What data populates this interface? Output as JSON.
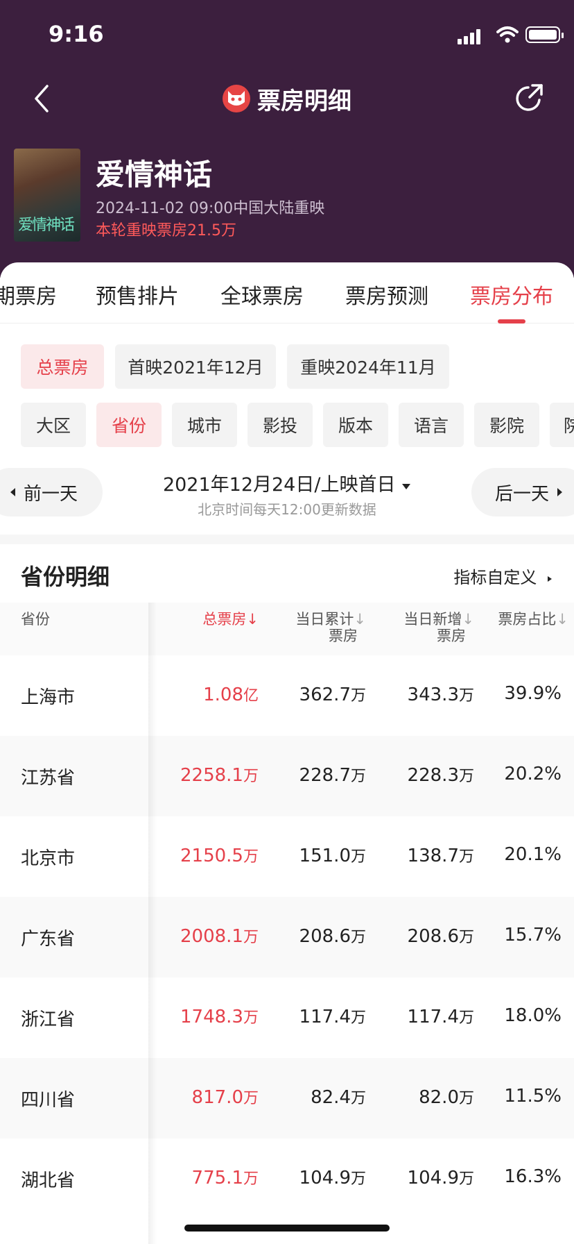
{
  "status_bar": {
    "time": "9:16"
  },
  "nav": {
    "title": "票房明细"
  },
  "movie": {
    "title": "爱情神话",
    "release": "2024-11-02 09:00中国大陆重映",
    "round_box_office": "本轮重映票房21.5万",
    "poster_text": "爱情神话"
  },
  "tabs": [
    "期票房",
    "预售排片",
    "全球票房",
    "票房预测",
    "票房分布"
  ],
  "filters": {
    "period": [
      "总票房",
      "首映2021年12月",
      "重映2024年11月"
    ],
    "dimension": [
      "大区",
      "省份",
      "城市",
      "影投",
      "版本",
      "语言",
      "影院",
      "院"
    ]
  },
  "date_nav": {
    "prev": "前一天",
    "next": "后一天",
    "date": "2021年12月24日/上映首日",
    "note": "北京时间每天12:00更新数据"
  },
  "section": {
    "title": "省份明细",
    "custom": "指标自定义"
  },
  "table": {
    "headers": {
      "province": "省份",
      "total": "总票房",
      "day_cum_1": "当日累计",
      "day_cum_2": "票房",
      "day_new_1": "当日新增",
      "day_new_2": "票房",
      "share": "票房占比"
    },
    "rows": [
      {
        "province": "上海市",
        "total": "1.08",
        "total_unit": "亿",
        "day_cum": "362.7",
        "day_new": "343.3",
        "share": "39.9%"
      },
      {
        "province": "江苏省",
        "total": "2258.1",
        "total_unit": "万",
        "day_cum": "228.7",
        "day_new": "228.3",
        "share": "20.2%"
      },
      {
        "province": "北京市",
        "total": "2150.5",
        "total_unit": "万",
        "day_cum": "151.0",
        "day_new": "138.7",
        "share": "20.1%"
      },
      {
        "province": "广东省",
        "total": "2008.1",
        "total_unit": "万",
        "day_cum": "208.6",
        "day_new": "208.6",
        "share": "15.7%"
      },
      {
        "province": "浙江省",
        "total": "1748.3",
        "total_unit": "万",
        "day_cum": "117.4",
        "day_new": "117.4",
        "share": "18.0%"
      },
      {
        "province": "四川省",
        "total": "817.0",
        "total_unit": "万",
        "day_cum": "82.4",
        "day_new": "82.0",
        "share": "11.5%"
      },
      {
        "province": "湖北省",
        "total": "775.1",
        "total_unit": "万",
        "day_cum": "104.9",
        "day_new": "104.9",
        "share": "16.3%"
      }
    ],
    "unit_wan": "万"
  },
  "colors": {
    "header_bg": "#3c1f3e",
    "accent": "#e5404a",
    "box_office_text": "#ff5a5a"
  }
}
